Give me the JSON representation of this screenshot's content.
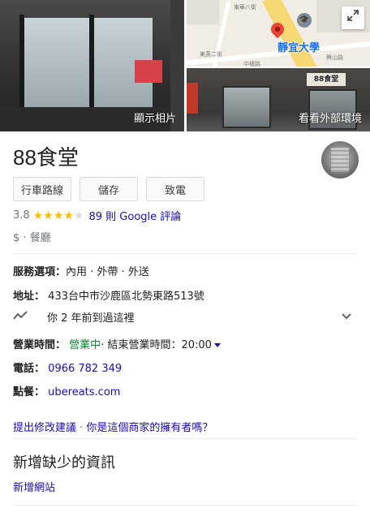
{
  "photos": {
    "main_label": "顯示相片",
    "street_label": "看看外部環境",
    "street_sign": "88食堂",
    "map": {
      "poi_label": "靜宜大學",
      "road_labels": [
        "東華八街",
        "東英二街",
        "興山路",
        "中棲路"
      ]
    }
  },
  "place": {
    "title": "88食堂"
  },
  "actions": {
    "directions": "行車路線",
    "save": "儲存",
    "call": "致電"
  },
  "rating": {
    "score": "3.8",
    "stars_filled": 4,
    "stars_total": 5,
    "reviews_label": "89 則 Google 評論"
  },
  "price": {
    "label": "$ · 餐廳"
  },
  "info": {
    "service_label": "服務選項",
    "service_value": "內用 · 外帶 · 外送",
    "address_label": "地址",
    "address_value": "433台中市沙鹿區北勢東路513號",
    "visit_text": "你 2 年前到過這裡",
    "hours_label": "營業時間",
    "hours_open": "營業中",
    "hours_close": "· 結束營業時間：20:00",
    "phone_label": "電話",
    "phone_value": "0966 782 349",
    "order_label": "點餐",
    "order_value": "ubereats.com"
  },
  "suggest": {
    "edit_link": "提出修改建議",
    "separator": " · ",
    "owner_link": "你是這個商家的擁有者嗎？"
  },
  "missing": {
    "title": "新增缺少的資訊",
    "add_website": "新增網站"
  }
}
